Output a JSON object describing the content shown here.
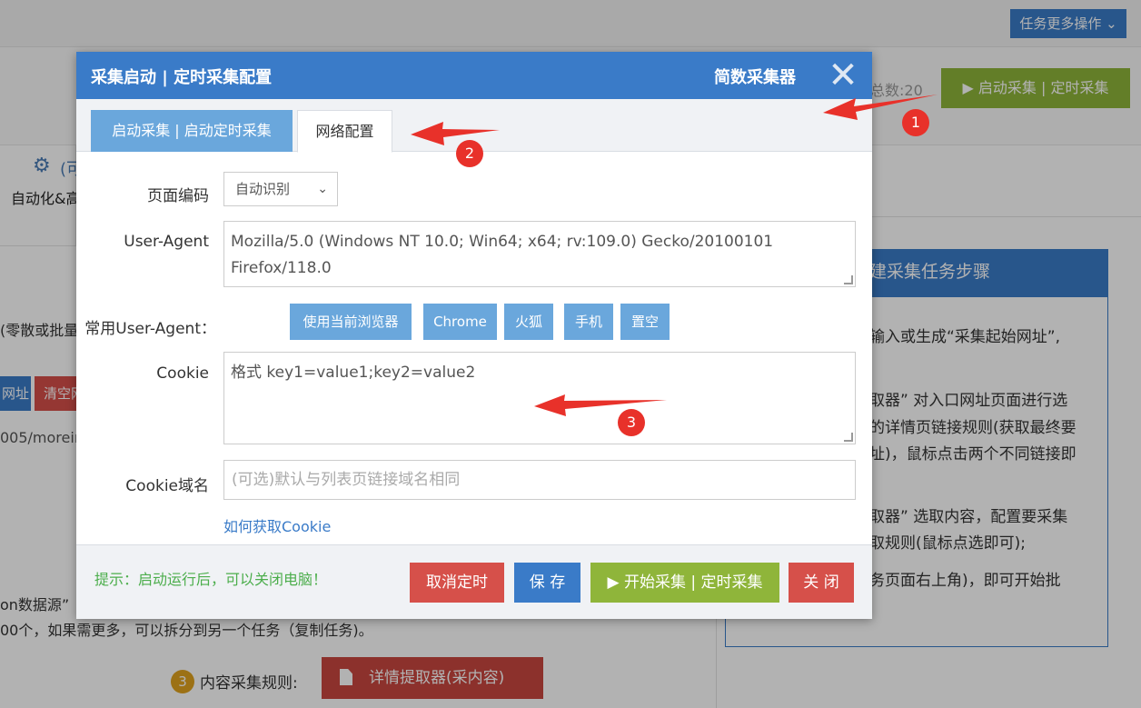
{
  "background": {
    "more_ops_label": "任务更多操作 ⌄",
    "total_count": "总数:20",
    "start_button_label": "▶ 启动采集 | 定时采集",
    "gear_label": "(可",
    "auto_label": "自动化&高",
    "left_text": "(零散或批量",
    "addr_button": "网址",
    "clear_button": "清空网",
    "url_fragment": "005/moreinf",
    "json_line": "on数据源”",
    "limit_line": "00个，如果需更多，可以拆分到另一个任务（复制任务)。",
    "rule_number": "3",
    "rule_label": "内容采集规则:",
    "detail_button_label": "详情提取器(采内容)",
    "steps_panel": {
      "title": "建采集任务步骤",
      "lines": [
        "输入或生成“采集起始网址”,",
        "取器” 对入口网址页面进行选",
        "的详情页链接规则(获取最终要",
        "址)，鼠标点击两个不同链接即",
        "取器” 选取内容，配置要采集",
        "取规则(鼠标点选即可);",
        "务页面右上角)，即可开始批"
      ]
    }
  },
  "modal": {
    "title": "采集启动 | 定时采集配置",
    "brand": "简数采集器",
    "close_glyph": "✕",
    "tabs": [
      {
        "label": "启动采集 | 启动定时采集",
        "active": false
      },
      {
        "label": "网络配置",
        "active": true
      }
    ],
    "form": {
      "encoding_label": "页面编码",
      "encoding_value": "自动识别",
      "ua_label": "User-Agent",
      "ua_value_line1": "Mozilla/5.0 (Windows NT 10.0; Win64; x64; rv:109.0) Gecko/20100101",
      "ua_value_line2": "Firefox/118.0",
      "common_ua_label": "常用User-Agent：",
      "ua_buttons": [
        "使用当前浏览器",
        "Chrome",
        "火狐",
        "手机",
        "置空"
      ],
      "cookie_label": "Cookie",
      "cookie_placeholder": "格式 key1=value1;key2=value2",
      "cookie_domain_label": "Cookie域名",
      "cookie_domain_placeholder": "(可选)默认与列表页链接域名相同",
      "how_to_link": "如何获取Cookie"
    },
    "footer": {
      "tip": "提示：启动运行后，可以关闭电脑！",
      "cancel_timer": "取消定时",
      "save": "保 存",
      "start": "▶ 开始采集 | 定时采集",
      "close": "关 闭"
    }
  },
  "annotations": {
    "badges": [
      "1",
      "2",
      "3"
    ],
    "arrow_color": "#e8312a"
  }
}
